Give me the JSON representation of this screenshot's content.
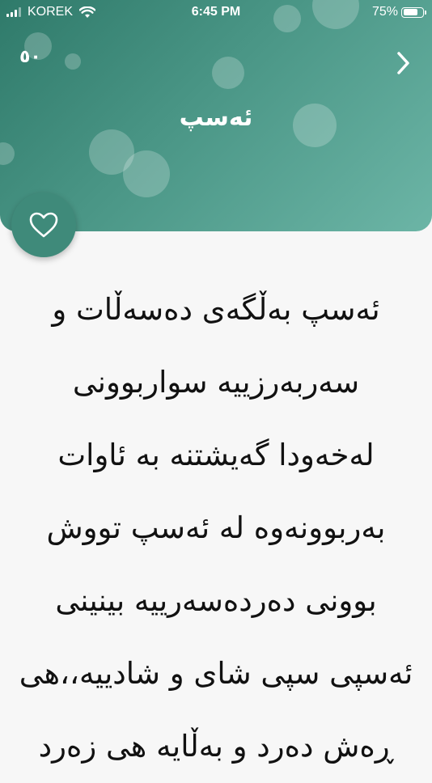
{
  "status_bar": {
    "carrier": "KOREK",
    "time": "6:45 PM",
    "battery_text": "75%",
    "battery_level": 0.75
  },
  "header": {
    "poem_number": "٥٠",
    "title": "ئەسپ",
    "next_icon": "chevron-right-icon",
    "colors": {
      "gradient_start": "#2f7a6a",
      "gradient_end": "#6cb5a6"
    }
  },
  "favorite": {
    "icon": "heart-icon",
    "color": "#3f8a7a"
  },
  "poem": {
    "lines": [
      "ئەسپ بەڵگەی دەسەڵات و",
      "سەربەرزییە سواربوونی",
      "لەخەودا گەیشتنە بە ئاوات",
      "بەربوونەوە لە ئەسپ تووش",
      "بوونی دەردەسەرییە بینینی",
      "ئەسپی سپی شای و شادییە،،هی",
      "ڕەش دەرد و بەڵایە هی زەرد"
    ]
  }
}
